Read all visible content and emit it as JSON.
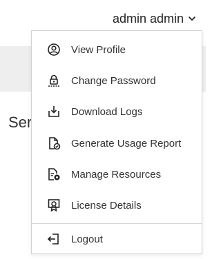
{
  "header": {
    "user_name": "admin admin",
    "chevron_icon": "chevron-down-icon"
  },
  "background": {
    "partial_text": "Ser"
  },
  "user_menu": {
    "items": [
      {
        "label": "View Profile",
        "icon": "user-circle-icon"
      },
      {
        "label": "Change Password",
        "icon": "lock-password-icon"
      },
      {
        "label": "Download Logs",
        "icon": "download-tray-icon"
      },
      {
        "label": "Generate Usage Report",
        "icon": "report-check-icon"
      },
      {
        "label": "Manage Resources",
        "icon": "manage-file-gear-icon"
      },
      {
        "label": "License Details",
        "icon": "license-badge-icon"
      },
      {
        "label": "Logout",
        "icon": "logout-icon"
      }
    ]
  }
}
